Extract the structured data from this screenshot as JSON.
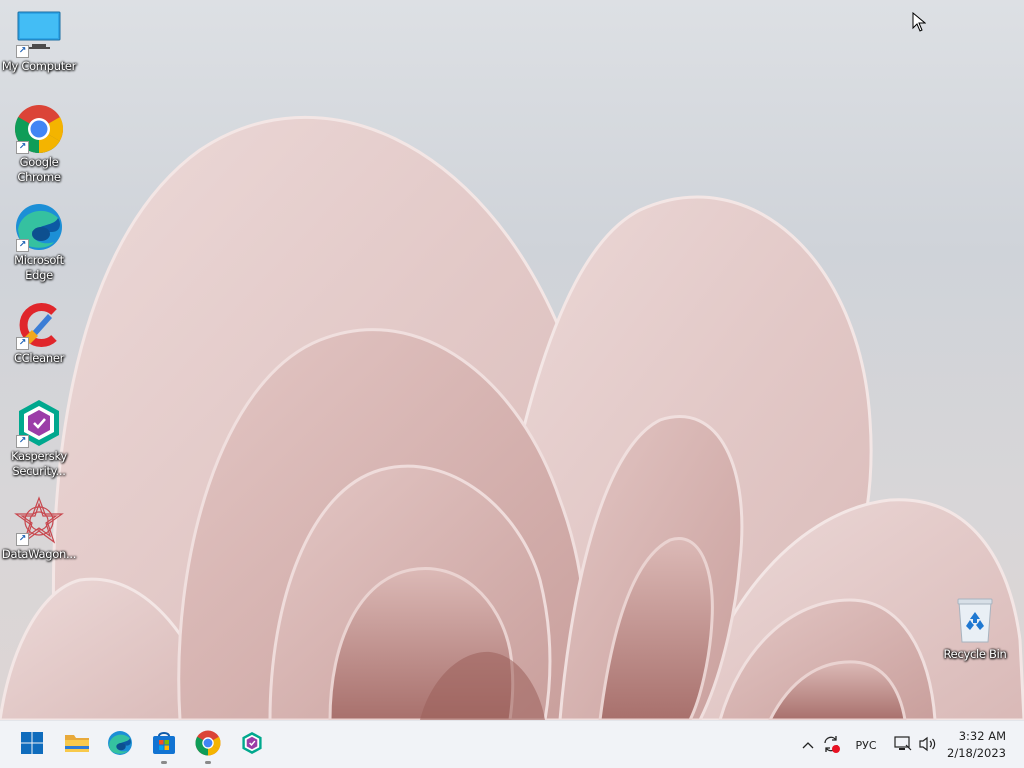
{
  "desktop": {
    "icons": [
      {
        "label": "My Computer",
        "icon": "monitor-icon"
      },
      {
        "label": "Google Chrome",
        "icon": "chrome-icon"
      },
      {
        "label": "Microsoft Edge",
        "icon": "edge-icon"
      },
      {
        "label": "CCleaner",
        "icon": "ccleaner-icon"
      },
      {
        "label": "Kaspersky Security...",
        "icon": "kaspersky-icon"
      },
      {
        "label": "DataWagon...",
        "icon": "datawagon-icon"
      },
      {
        "label": "Recycle Bin",
        "icon": "recycle-bin-icon"
      }
    ]
  },
  "taskbar": {
    "pinned": [
      {
        "name": "Start",
        "icon": "windows-start-icon"
      },
      {
        "name": "File Explorer",
        "icon": "folder-icon"
      },
      {
        "name": "Microsoft Edge",
        "icon": "edge-icon"
      },
      {
        "name": "Microsoft Store",
        "icon": "store-icon"
      },
      {
        "name": "Google Chrome",
        "icon": "chrome-icon"
      },
      {
        "name": "Kaspersky",
        "icon": "kaspersky-icon"
      }
    ],
    "tray": {
      "language": "РУС",
      "time": "3:32 AM",
      "date": "2/18/2023"
    }
  },
  "colors": {
    "taskbar_bg": "#f1f3f7",
    "accent": "#0067c0",
    "petal": "#e8cfcd"
  }
}
